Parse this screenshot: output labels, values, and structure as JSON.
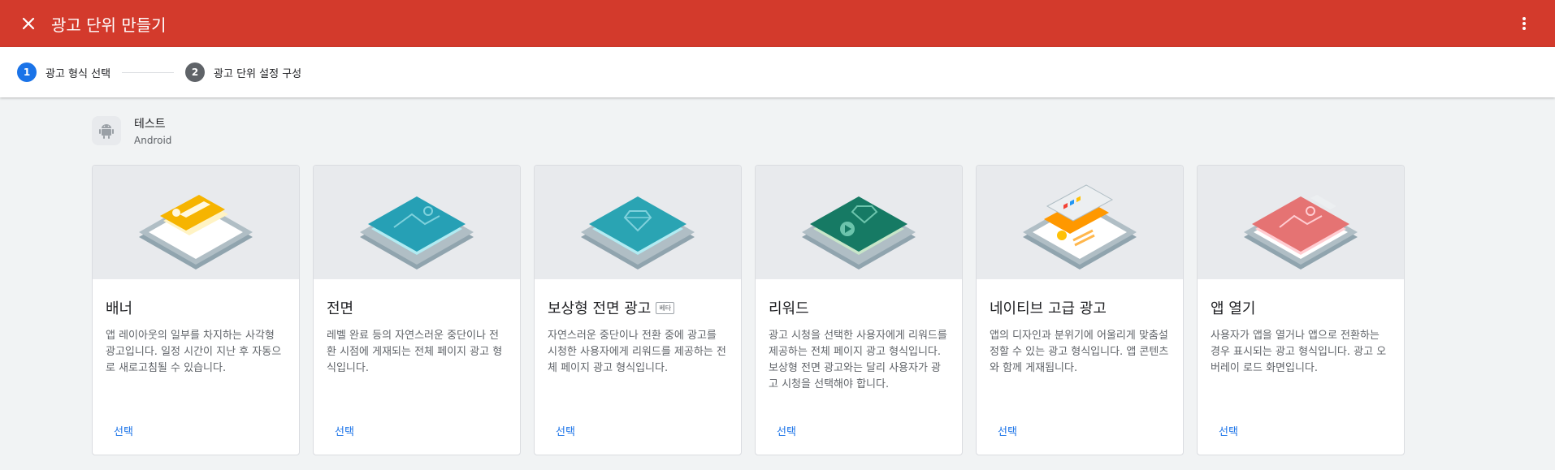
{
  "topbar": {
    "title": "광고 단위 만들기",
    "color": "#d33a2c"
  },
  "stepper": {
    "steps": [
      {
        "number": "1",
        "label": "광고 형식 선택"
      },
      {
        "number": "2",
        "label": "광고 단위 설정 구성"
      }
    ]
  },
  "app": {
    "name": "테스트",
    "platform": "Android",
    "icon": "android-icon"
  },
  "cards": [
    {
      "title": "배너",
      "description": "앱 레이아웃의 일부를 차지하는 사각형 광고입니다. 일정 시간이 지난 후 자동으로 새로고침될 수 있습니다.",
      "action": "선택",
      "illustration": "banner-illustration"
    },
    {
      "title": "전면",
      "description": "레벨 완료 등의 자연스러운 중단이나 전환 시점에 게재되는 전체 페이지 광고 형식입니다.",
      "action": "선택",
      "illustration": "interstitial-illustration"
    },
    {
      "title": "보상형 전면 광고",
      "badge": "베타",
      "description": "자연스러운 중단이나 전환 중에 광고를 시청한 사용자에게 리워드를 제공하는 전체 페이지 광고 형식입니다.",
      "action": "선택",
      "illustration": "rewarded-interstitial-illustration"
    },
    {
      "title": "리워드",
      "description": "광고 시청을 선택한 사용자에게 리워드를 제공하는 전체 페이지 광고 형식입니다. 보상형 전면 광고와는 달리 사용자가 광고 시청을 선택해야 합니다.",
      "action": "선택",
      "illustration": "rewarded-illustration"
    },
    {
      "title": "네이티브 고급 광고",
      "description": "앱의 디자인과 분위기에 어울리게 맞춤설정할 수 있는 광고 형식입니다. 앱 콘텐츠와 함께 게재됩니다.",
      "action": "선택",
      "illustration": "native-illustration"
    },
    {
      "title": "앱 열기",
      "description": "사용자가 앱을 열거나 앱으로 전환하는 경우 표시되는 광고 형식입니다. 광고 오버레이 로드 화면입니다.",
      "action": "선택",
      "illustration": "app-open-illustration"
    }
  ]
}
